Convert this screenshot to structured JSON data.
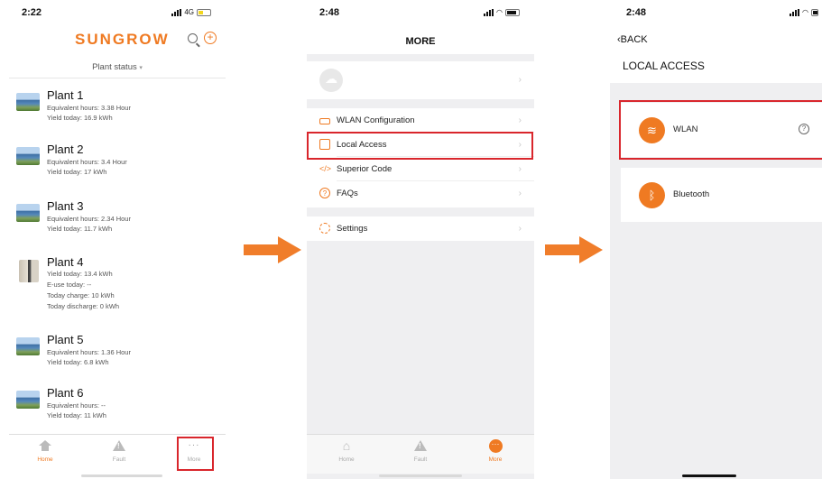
{
  "colors": {
    "accent": "#ef7a22",
    "highlight_box": "#d9262c",
    "arrow": "#f07d2a"
  },
  "screen1": {
    "time": "2:22",
    "network": "4G",
    "brand": "SUNGROW",
    "plant_status_label": "Plant status",
    "plants": [
      {
        "name": "Plant 1",
        "lines": [
          "Equivalent hours: 3.38 Hour",
          "Yield today: 16.9 kWh"
        ]
      },
      {
        "name": "Plant 2",
        "lines": [
          "Equivalent hours: 3.4 Hour",
          "Yield today: 17 kWh"
        ]
      },
      {
        "name": "Plant 3",
        "lines": [
          "Equivalent hours: 2.34 Hour",
          "Yield today: 11.7 kWh"
        ]
      },
      {
        "name": "Plant 4",
        "lines": [
          "Yield today: 13.4 kWh",
          "E-use today: --",
          "Today charge: 10 kWh",
          "Today discharge: 0 kWh"
        ]
      },
      {
        "name": "Plant 5",
        "lines": [
          "Equivalent hours: 1.36 Hour",
          "Yield today: 6.8 kWh"
        ]
      },
      {
        "name": "Plant 6",
        "lines": [
          "Equivalent hours: --",
          "Yield today: 11 kWh"
        ]
      }
    ],
    "tabs": {
      "home": "Home",
      "fault": "Fault",
      "more": "More"
    }
  },
  "screen2": {
    "time": "2:48",
    "title": "MORE",
    "menu": {
      "wlan_config": "WLAN Configuration",
      "local_access": "Local Access",
      "superior_code": "Superior Code",
      "faqs": "FAQs",
      "settings": "Settings"
    },
    "tabs": {
      "home": "Home",
      "fault": "Fault",
      "more": "More"
    }
  },
  "screen3": {
    "time": "2:48",
    "back_label": "BACK",
    "title": "LOCAL ACCESS",
    "options": {
      "wlan": "WLAN",
      "bluetooth": "Bluetooth"
    }
  }
}
